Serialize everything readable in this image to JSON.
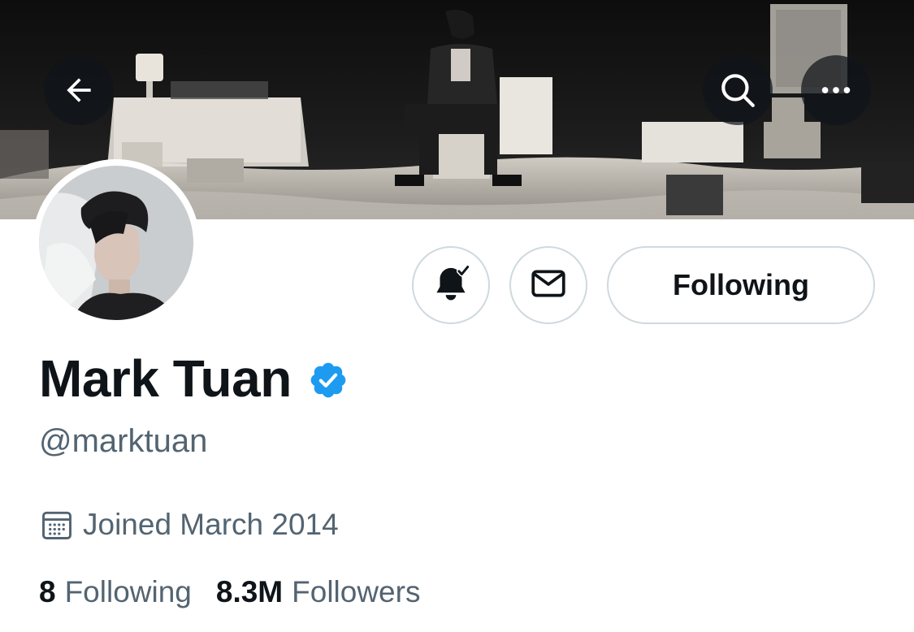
{
  "profile": {
    "display_name": "Mark Tuan",
    "handle": "@marktuan",
    "verified": true,
    "joined": "Joined March 2014",
    "following_count": "8",
    "following_label": "Following",
    "followers_count": "8.3M",
    "followers_label": "Followers"
  },
  "actions": {
    "follow_state_label": "Following",
    "notifications_icon": "bell-check-icon",
    "message_icon": "envelope-icon"
  },
  "header": {
    "back_icon": "arrow-left-icon",
    "search_icon": "search-icon",
    "more_icon": "more-horizontal-icon"
  },
  "colors": {
    "text_primary": "#0f1419",
    "text_secondary": "#536471",
    "border": "#cfd9de",
    "verified_blue": "#1d9bf0"
  }
}
